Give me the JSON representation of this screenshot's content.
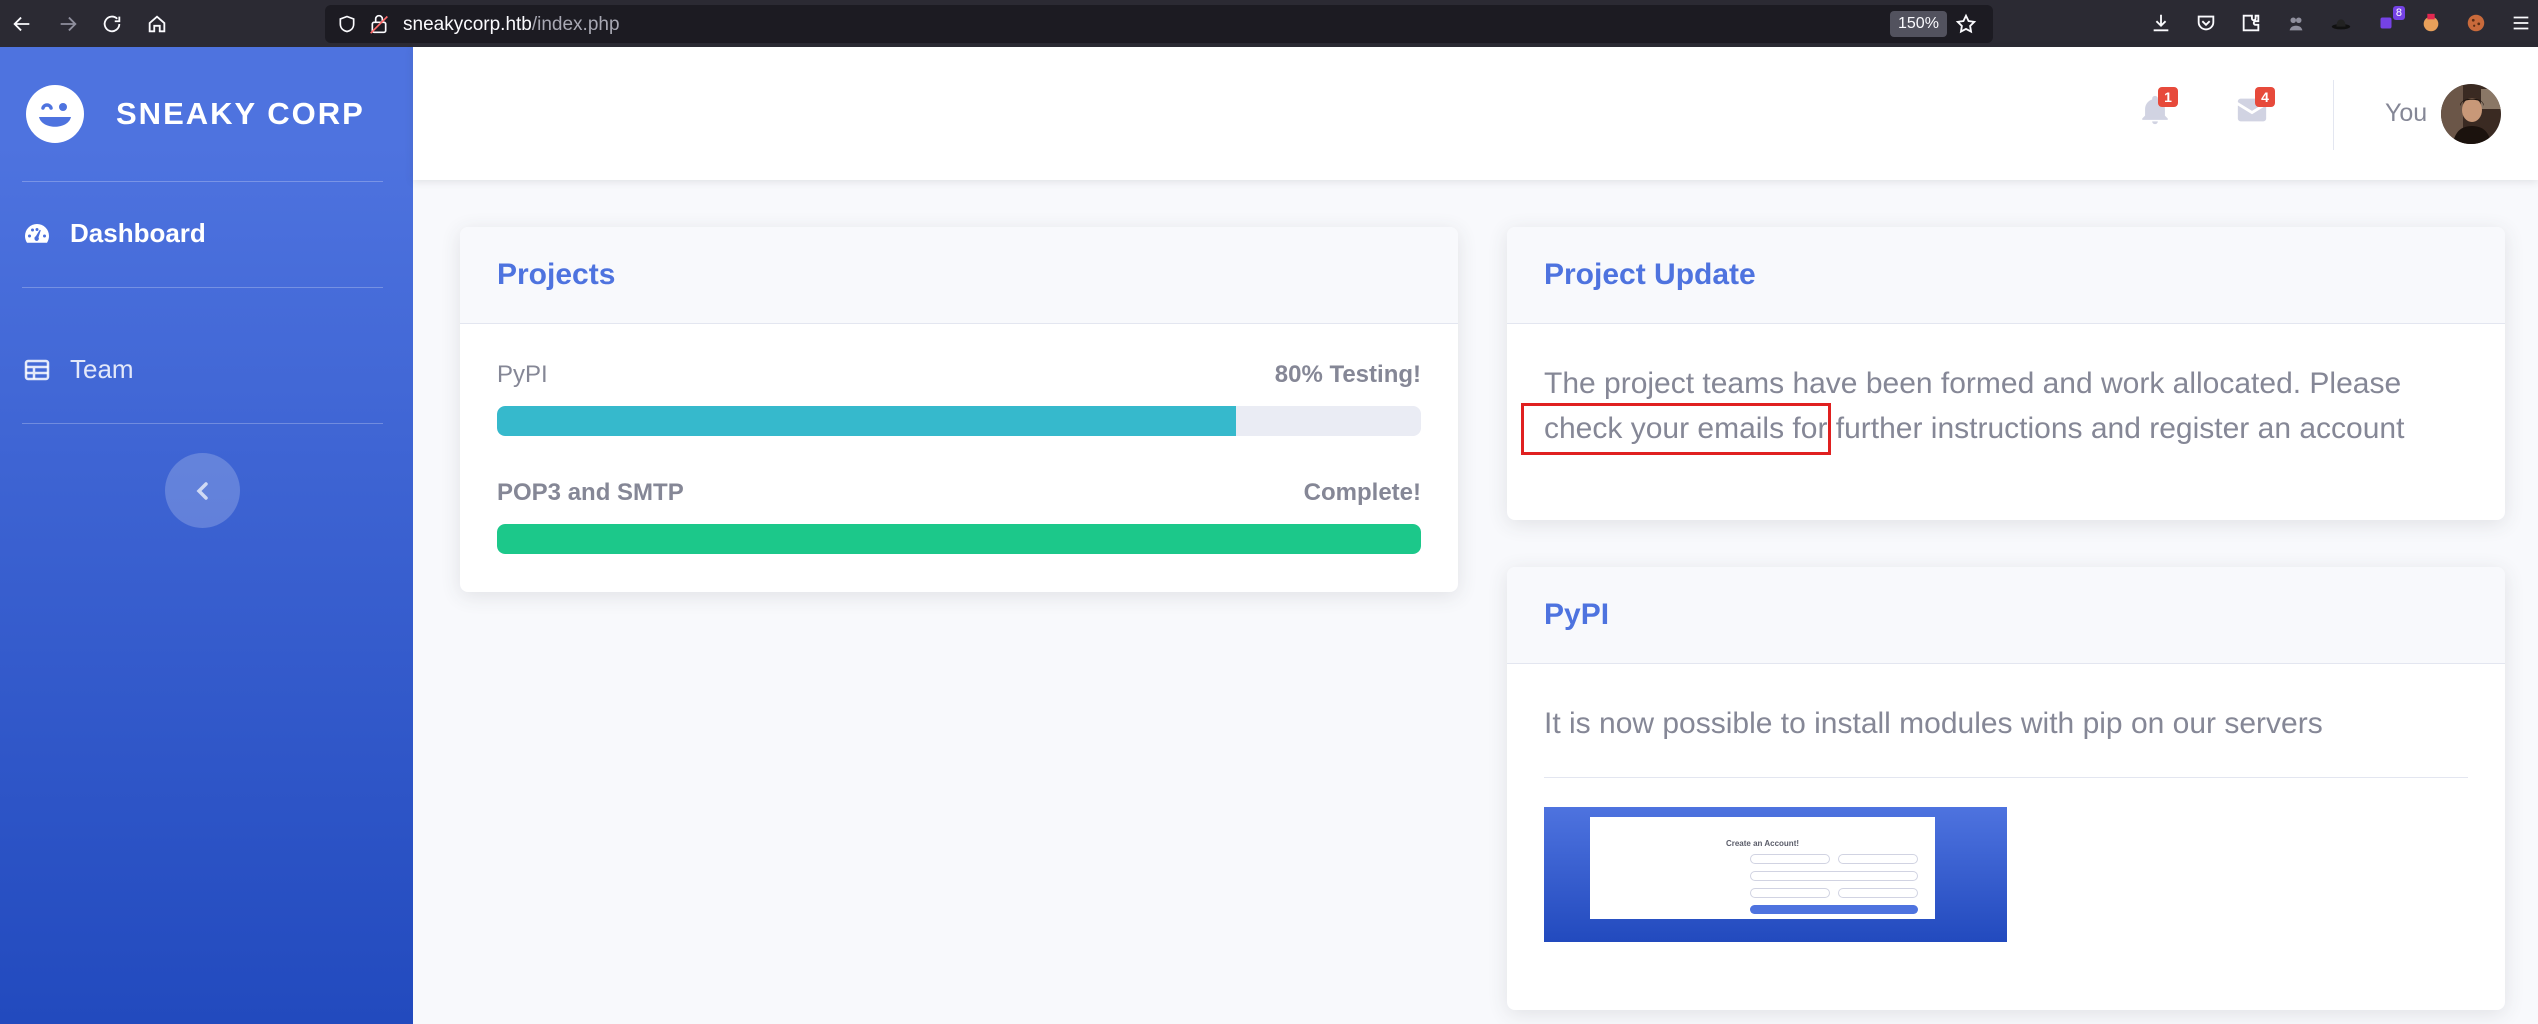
{
  "browser": {
    "url_host": "sneakycorp.htb",
    "url_path": "/index.php",
    "zoom": "150%",
    "extension_badge": "8"
  },
  "sidebar": {
    "brand": "SNEAKY CORP",
    "items": [
      {
        "label": "Dashboard",
        "icon": "tachometer-icon",
        "active": true
      },
      {
        "label": "Team",
        "icon": "table-icon",
        "active": false
      }
    ],
    "toggle_icon": "chevron-left-icon"
  },
  "topbar": {
    "alerts_count": "1",
    "messages_count": "4",
    "user_name": "You"
  },
  "projects": {
    "title": "Projects",
    "items": [
      {
        "name": "PyPI",
        "status": "80% Testing!",
        "progress": 80,
        "color": "#36b9cc"
      },
      {
        "name": "POP3 and SMTP",
        "status": "Complete!",
        "progress": 100,
        "color": "#1cc88a"
      }
    ]
  },
  "project_update": {
    "title": "Project Update",
    "text": "The project teams have been formed and work allocated. Please check your emails for further instructions and register an account"
  },
  "pypi_card": {
    "title": "PyPI",
    "text": "It is now possible to install modules with pip on our servers",
    "thumbnail_title": "Create an Account!"
  },
  "colors": {
    "primary": "#4e73df",
    "info": "#36b9cc",
    "success": "#1cc88a",
    "danger": "#e74a3b",
    "annotation": "#e02020"
  }
}
